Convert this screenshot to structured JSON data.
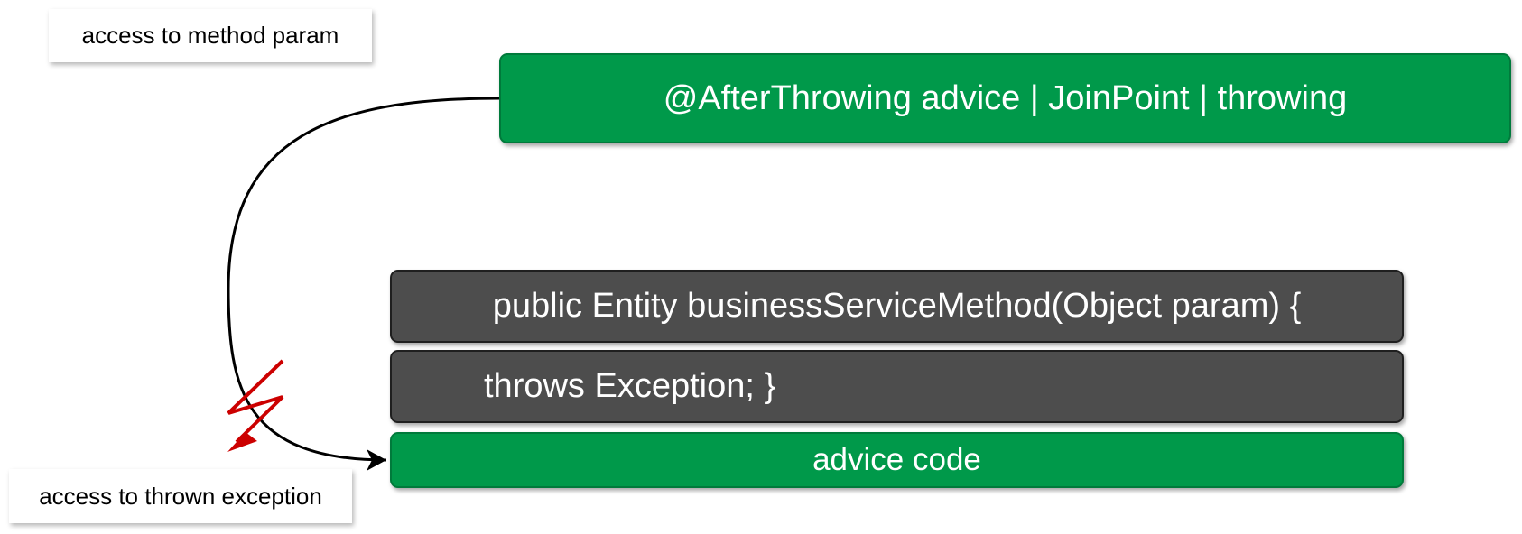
{
  "notes": {
    "method_param": "access to method param",
    "thrown_exception": "access to thrown exception"
  },
  "boxes": {
    "advice_header": "@AfterThrowing advice | JoinPoint | throwing",
    "method_signature": "public Entity businessServiceMethod(Object param) {",
    "method_throws": "throws Exception; }",
    "advice_code": "advice code"
  },
  "colors": {
    "advice_green": "#00994a",
    "method_gray": "#4d4d4d",
    "exception_red": "#cc0000",
    "connector": "#000000"
  }
}
